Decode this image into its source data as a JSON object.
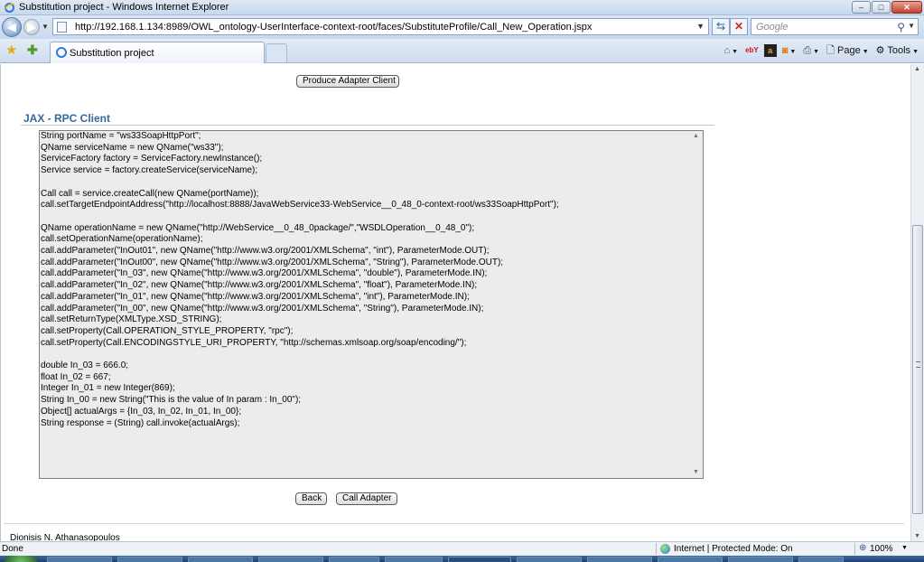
{
  "window": {
    "title": "Substitution project - Windows Internet Explorer",
    "buttons": {
      "minimize": "–",
      "maximize": "□",
      "close": "✕"
    }
  },
  "address_bar": {
    "url": "http://192.168.1.134:8989/OWL_ontology-UserInterface-context-root/faces/SubstituteProfile/Call_New_Operation.jspx",
    "search_placeholder": "Google"
  },
  "tabs": [
    {
      "label": "Substitution project"
    }
  ],
  "command_bar": {
    "page_label": "Page",
    "tools_label": "Tools",
    "ebay_label": "ebY",
    "amazon_label": "a"
  },
  "page": {
    "produce_button": "Produce Adapter Client",
    "section_title": "JAX - RPC Client",
    "code_text": "String portName = \"ws33SoapHttpPort\";\nQName serviceName = new QName(\"ws33\");\nServiceFactory factory = ServiceFactory.newInstance();\nService service = factory.createService(serviceName);\n\nCall call = service.createCall(new QName(portName));\ncall.setTargetEndpointAddress(\"http://localhost:8888/JavaWebService33-WebService__0_48_0-context-root/ws33SoapHttpPort\");\n\nQName operationName = new QName(\"http://WebService__0_48_0package/\",\"WSDLOperation__0_48_0\");\ncall.setOperationName(operationName);\ncall.addParameter(\"InOut01\", new QName(\"http://www.w3.org/2001/XMLSchema\", \"int\"), ParameterMode.OUT);\ncall.addParameter(\"InOut00\", new QName(\"http://www.w3.org/2001/XMLSchema\", \"String\"), ParameterMode.OUT);\ncall.addParameter(\"In_03\", new QName(\"http://www.w3.org/2001/XMLSchema\", \"double\"), ParameterMode.IN);\ncall.addParameter(\"In_02\", new QName(\"http://www.w3.org/2001/XMLSchema\", \"float\"), ParameterMode.IN);\ncall.addParameter(\"In_01\", new QName(\"http://www.w3.org/2001/XMLSchema\", \"int\"), ParameterMode.IN);\ncall.addParameter(\"In_00\", new QName(\"http://www.w3.org/2001/XMLSchema\", \"String\"), ParameterMode.IN);\ncall.setReturnType(XMLType.XSD_STRING);\ncall.setProperty(Call.OPERATION_STYLE_PROPERTY, \"rpc\");\ncall.setProperty(Call.ENCODINGSTYLE_URI_PROPERTY, \"http://schemas.xmlsoap.org/soap/encoding/\");\n\ndouble In_03 = 666.0;\nfloat In_02 = 667;\nInteger In_01 = new Integer(869);\nString In_00 = new String(\"This is the value of In param : In_00\");\nObject[] actualArgs = {In_03, In_02, In_01, In_00};\nString response = (String) call.invoke(actualArgs);",
    "back_button": "Back",
    "call_adapter_button": "Call Adapter",
    "footer_text": "Dionisis N. Athanasopoulos"
  },
  "status_bar": {
    "status": "Done",
    "zone": "Internet | Protected Mode: On",
    "zoom": "100%"
  },
  "colors": {
    "section_title": "#3566a4",
    "code_background": "#ececec",
    "chrome_blue": "#c9d9ee"
  }
}
